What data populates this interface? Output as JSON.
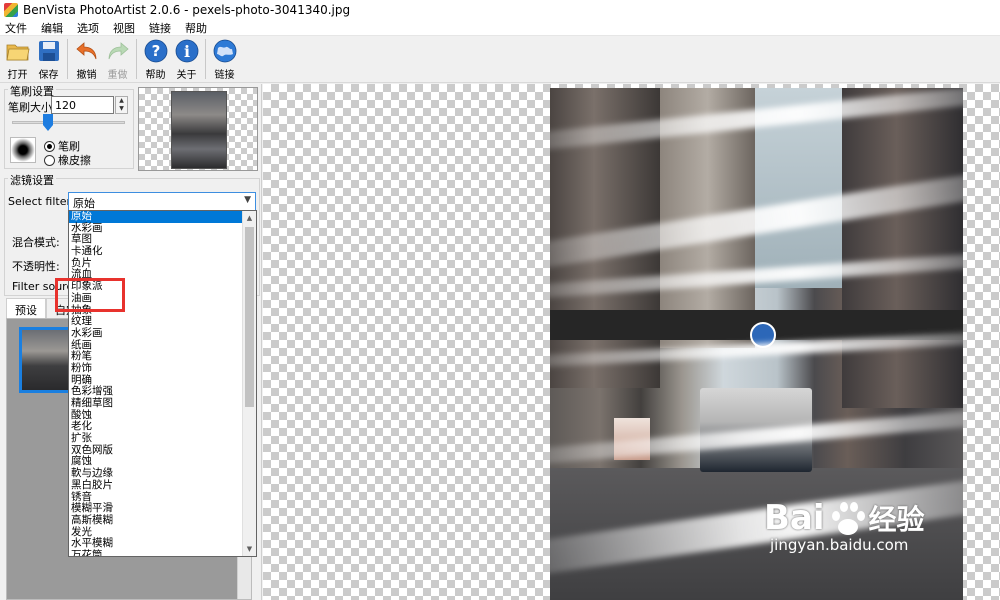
{
  "window": {
    "title": "BenVista PhotoArtist 2.0.6 - pexels-photo-3041340.jpg"
  },
  "menu": [
    "文件",
    "编辑",
    "选项",
    "视图",
    "链接",
    "帮助"
  ],
  "toolbar": {
    "open": "打开",
    "save": "保存",
    "undo": "撤销",
    "redo": "重做",
    "help": "帮助",
    "about": "关于",
    "link": "链接"
  },
  "brush_settings": {
    "title": "笔刷设置",
    "size_label": "笔刷大小:",
    "size_value": "120",
    "brush_radio": "笔刷",
    "eraser_radio": "橡皮擦"
  },
  "filter_settings": {
    "title": "滤镜设置",
    "select_label": "Select filter:",
    "selected": "原始",
    "blend_label": "混合模式:",
    "opacity_label": "不透明性:",
    "source_label": "Filter source:"
  },
  "tabs": [
    "预设",
    "自定"
  ],
  "filter_options": [
    "原始",
    "水彩画",
    "草图",
    "卡通化",
    "负片",
    "流血",
    "印象派",
    "油画",
    "抽象",
    "纹理",
    "水彩画",
    "纸画",
    "粉笔",
    "粉饰",
    "明确",
    "色彩增强",
    "精细草图",
    "酸蚀",
    "老化",
    "扩张",
    "双色网版",
    "腐蚀",
    "軟与边缘",
    "黑白胶片",
    "锈音",
    "模糊平滑",
    "高斯模糊",
    "发光",
    "水平模糊",
    "万花筒"
  ],
  "watermark": {
    "brand": "Bai",
    "brand_suffix": "经验",
    "url": "jingyan.baidu.com"
  },
  "colors": {
    "accent": "#0078d7",
    "highlight": "#e8322d"
  }
}
